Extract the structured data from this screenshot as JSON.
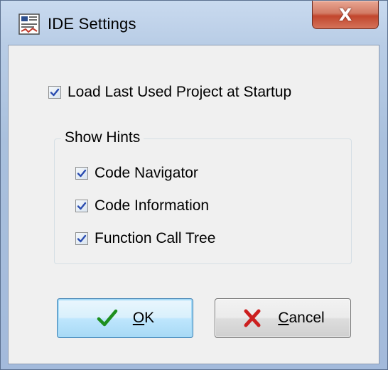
{
  "window": {
    "title": "IDE Settings",
    "close_glyph": "X"
  },
  "options": {
    "load_last_project": {
      "label": "Load Last Used Project at Startup",
      "checked": true
    }
  },
  "show_hints": {
    "title": "Show Hints",
    "items": [
      {
        "label": "Code Navigator",
        "checked": true
      },
      {
        "label": "Code Information",
        "checked": true
      },
      {
        "label": "Function Call Tree",
        "checked": true
      }
    ]
  },
  "buttons": {
    "ok": {
      "mnemonic": "O",
      "rest": "K",
      "icon": "checkmark-icon"
    },
    "cancel": {
      "mnemonic": "C",
      "rest": "ancel",
      "icon": "red-x-icon"
    }
  },
  "colors": {
    "check": "#2a4cb0",
    "ok_icon": "#1e8f1e",
    "cancel_icon": "#cc1f1f"
  }
}
